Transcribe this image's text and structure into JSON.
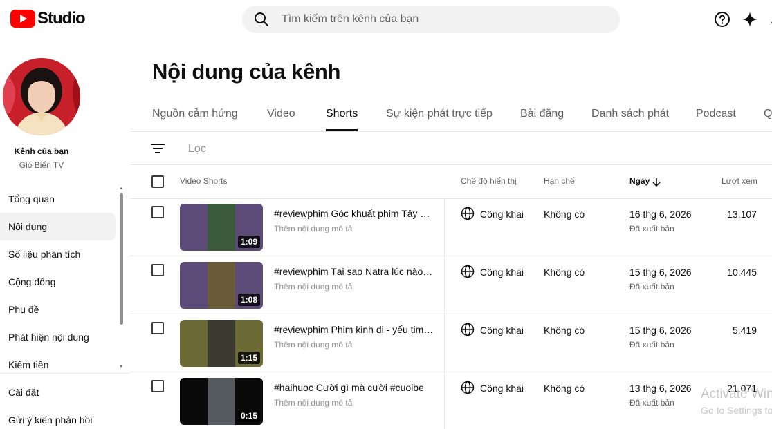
{
  "brand": {
    "name": "Studio",
    "logo_icon": "youtube-play-icon",
    "color": "#ff0000"
  },
  "search": {
    "placeholder": "Tìm kiếm trên kênh của bạn"
  },
  "header_icons": [
    "help-icon",
    "sparkle-icon"
  ],
  "sidebar": {
    "channel_title": "Kênh của bạn",
    "channel_name": "Gió Biển TV",
    "items": [
      {
        "label": "Tổng quan"
      },
      {
        "label": "Nội dung",
        "active": true
      },
      {
        "label": "Số liệu phân tích"
      },
      {
        "label": "Cộng đồng"
      },
      {
        "label": "Phụ đề"
      },
      {
        "label": "Phát hiện nội dung"
      },
      {
        "label": "Kiếm tiền"
      }
    ],
    "bottom_items": [
      {
        "label": "Cài đặt"
      },
      {
        "label": "Gửi ý kiến phản hồi"
      }
    ]
  },
  "page": {
    "title": "Nội dung của kênh"
  },
  "tabs": [
    {
      "label": "Nguồn cảm hứng"
    },
    {
      "label": "Video"
    },
    {
      "label": "Shorts",
      "active": true
    },
    {
      "label": "Sự kiện phát trực tiếp"
    },
    {
      "label": "Bài đăng"
    },
    {
      "label": "Danh sách phát"
    },
    {
      "label": "Podcast"
    },
    {
      "label": "Q"
    }
  ],
  "filter": {
    "label": "Lọc"
  },
  "table": {
    "headers": {
      "video": "Video Shorts",
      "visibility": "Chế độ hiển thị",
      "restrictions": "Hạn chế",
      "date": "Ngày",
      "views": "Lượt xem"
    },
    "rows": [
      {
        "title": "#reviewphim Góc khuất phim Tây Du Ký",
        "description": "Thêm nội dung mô tả",
        "duration": "1:09",
        "visibility": "Công khai",
        "restrictions": "Không có",
        "date": "16 thg 6, 2026",
        "status": "Đã xuất bản",
        "views": "13.107",
        "thumb_bg": "#5c4a78",
        "thumb_inner": "#3b5a3a"
      },
      {
        "title": "#reviewphim Tại sao Natra lúc nào cũng vậy",
        "description": "Thêm nội dung mô tả",
        "duration": "1:08",
        "visibility": "Công khai",
        "restrictions": "Không có",
        "date": "15 thg 6, 2026",
        "status": "Đã xuất bản",
        "views": "10.445",
        "thumb_bg": "#5c4a78",
        "thumb_inner": "#6b5a3a"
      },
      {
        "title": "#reviewphim Phim kinh dị - yếu tim đừng xem",
        "description": "Thêm nội dung mô tả",
        "duration": "1:15",
        "visibility": "Công khai",
        "restrictions": "Không có",
        "date": "15 thg 6, 2026",
        "status": "Đã xuất bản",
        "views": "5.419",
        "thumb_bg": "#6b6a35",
        "thumb_inner": "#3a3a30"
      },
      {
        "title": "#haihuoc Cười gì mà cười #cuoibe",
        "description": "Thêm nội dung mô tả",
        "duration": "0:15",
        "visibility": "Công khai",
        "restrictions": "Không có",
        "date": "13 thg 6, 2026",
        "status": "Đã xuất bản",
        "views": "21.071",
        "thumb_bg": "#0a0a0a",
        "thumb_inner": "#555a60"
      }
    ]
  },
  "watermark": {
    "line1": "Activate Windows",
    "line2": "Go to Settings to activate Windows."
  }
}
